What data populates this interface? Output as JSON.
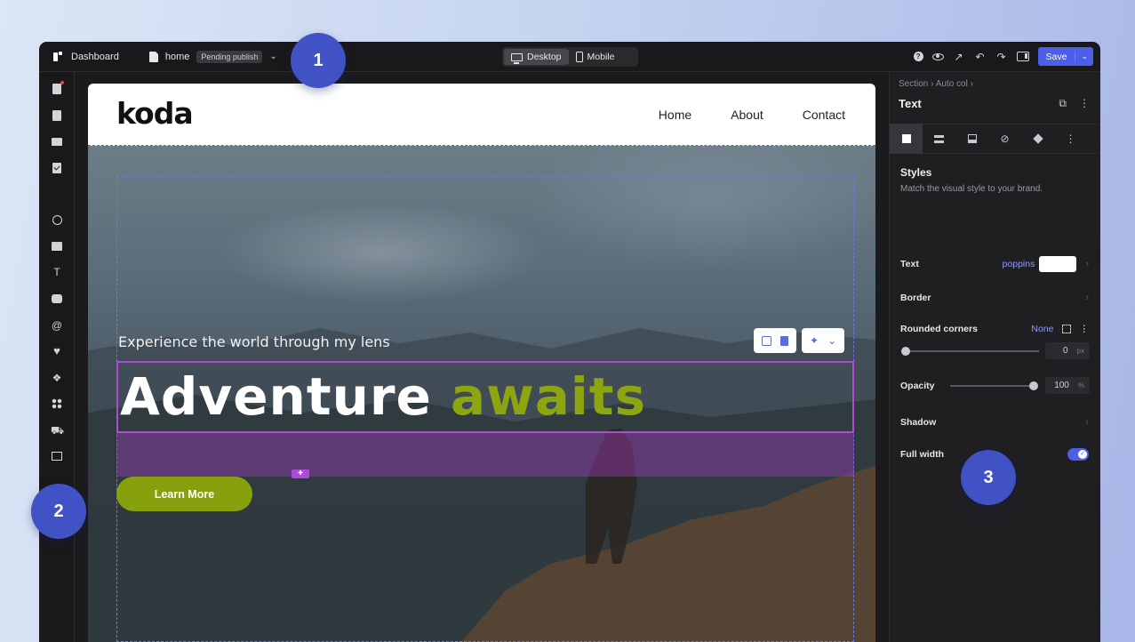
{
  "topbar": {
    "dashboard_label": "Dashboard",
    "page_name": "home",
    "status_badge": "Pending publish",
    "view_desktop": "Desktop",
    "view_mobile": "Mobile",
    "save_label": "Save",
    "active_view": "Desktop"
  },
  "site": {
    "logo": "koda",
    "nav": [
      "Home",
      "About",
      "Contact"
    ],
    "eyebrow": "Experience the world through my lens",
    "headline_main": "Adventure",
    "headline_accent": "awaits",
    "cta_label": "Learn More",
    "accent_color": "#87a00d",
    "selection_color": "#b24ad8"
  },
  "left_sidebar": {
    "icons": [
      "pages-icon",
      "page-icon",
      "card-icon",
      "form-icon",
      "shapes-icon",
      "image-icon",
      "text-icon",
      "chat-icon",
      "at-icon",
      "heart-icon",
      "components-icon",
      "apps-icon",
      "cart-icon",
      "slides-icon"
    ]
  },
  "panel": {
    "breadcrumb": "Section  ›  Auto col  ›",
    "title": "Text",
    "styles_heading": "Styles",
    "styles_subtitle": "Match the visual style to your brand.",
    "text_label": "Text",
    "font_name": "poppins",
    "border_label": "Border",
    "rounded_label": "Rounded corners",
    "rounded_mode": "None",
    "rounded_value": "0",
    "rounded_unit": "px",
    "opacity_label": "Opacity",
    "opacity_value": "100",
    "opacity_unit": "%",
    "shadow_label": "Shadow",
    "full_width_label": "Full width",
    "full_width_on": true
  },
  "callouts": [
    "1",
    "2",
    "3"
  ],
  "colors": {
    "brand": "#4d5fe8",
    "callout": "#4152c4"
  }
}
